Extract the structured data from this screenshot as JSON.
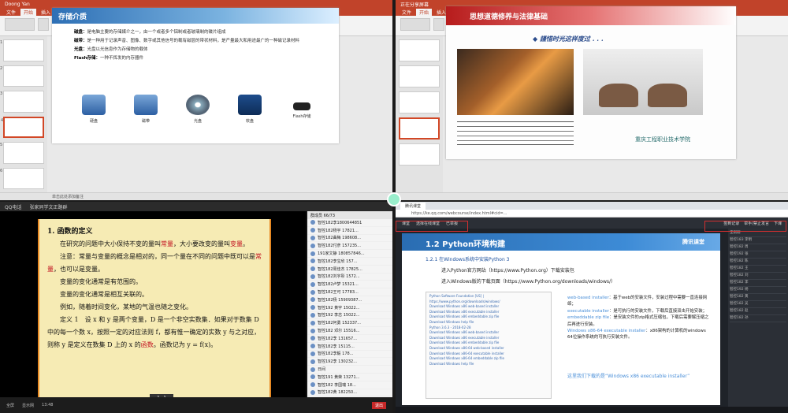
{
  "q1": {
    "title": "Doong Yan",
    "tabs": [
      "文件",
      "开始",
      "插入",
      "设计",
      "切换",
      "动画",
      "幻灯片放映",
      "审阅",
      "视图"
    ],
    "slide_header": "存储介质",
    "lines": [
      {
        "k": "磁盘：",
        "v": "是电脑主要的存储媒介之一，由一个或者多个铝制或者玻璃制的碟片组成"
      },
      {
        "k": "磁带：",
        "v": "是一种用于记录声音、图像、数字或其他信号的载有磁层的带状材料，是产量最大和用途最广的一种磁记录材料"
      },
      {
        "k": "光盘：",
        "v": "光盘以光信息作为存储物的载体"
      },
      {
        "k": "Flash存储：",
        "v": "一种不挥发的内存器件"
      }
    ],
    "icons": [
      {
        "name": "disk-icon",
        "label": "硬盘",
        "cls": ""
      },
      {
        "name": "tape-icon",
        "label": "磁带",
        "cls": ""
      },
      {
        "name": "cd-icon",
        "label": "光盘",
        "cls": "disc"
      },
      {
        "name": "floppy-icon",
        "label": "软盘",
        "cls": "floppy"
      },
      {
        "name": "usb-icon",
        "label": "Flash存储",
        "cls": "usb"
      }
    ],
    "status": "单击此处添加备注"
  },
  "q2": {
    "title": "正在分享屏幕",
    "tabs": [
      "文件",
      "开始",
      "插入",
      "设计",
      "切换",
      "动画",
      "幻灯片放映",
      "审阅",
      "视图"
    ],
    "slide_header": "思想道德修养与法律基础",
    "subtitle": "◆ 謹惜时光这样度过 . . .",
    "logo": "重庆工程职业技术学院"
  },
  "q3": {
    "bar_items": [
      "QQ电话",
      "张家同学文正路群"
    ],
    "heading": "1. 函数的定义",
    "paras": [
      "在研究的问题中大小保持不变的量叫常量，大小要改变的量叫变量。",
      "注意：常量与变量的概念是相对的，同一个量在不同的问题中既可以是常量，也可以是变量。",
      "变量的变化通常是有范围的。",
      "变量的变化通常是相互关联的。",
      "例如，随着时间变化，某地的气温也随之变化。",
      "定义 1　设 x 和 y 是两个变量，D 是一个非空实数集．如果对于数集 D 中的每一个数 x，按照一定的对应法则 f，都有惟一确定的实数 y 与之对应，则称 y 是定义在数集 D 上的 x 的函数。函数记为 y = f(x)。"
    ],
    "pager": "1 - 1",
    "members_title": "群成员 66/73",
    "members": [
      "智控182李1800644851",
      "智控182杨宇 17821...",
      "智控182曲梅 198608...",
      "智控182付彦 157235...",
      "191家文静 180857846...",
      "智控182李宝欣 157...",
      "智控182周佳杰 17825...",
      "智控182刘宇彤 1572...",
      "智控182卢梦 15321...",
      "智控182王可 17783...",
      "智控182杨 15909387...",
      "智控192 黄宇 15022...",
      "智控192 李志 15022...",
      "智控182何勇 152337...",
      "智控182 邓尔 15516...",
      "智控182李 131657...",
      "智控182李 15115...",
      "智控182李毅 178...",
      "智控192李 130232...",
      "日间",
      "智控191 黄荣 13271...",
      "智控182 李国瑞 18...",
      "智控182黄 182250...",
      "智控182 蒋天 1767...",
      "智控182 何婷 12227...",
      "智控182何 1816..."
    ],
    "bottom": [
      "全屏",
      "显示网",
      "13:48",
      "退出"
    ]
  },
  "q4": {
    "tab": "腾讯课堂",
    "addr": "https://ke.qq.com/webcourse/index.html#cid=...",
    "bar_items": [
      "课堂",
      "选择在线课堂",
      "已举报"
    ],
    "bar_right": [
      "签到记录",
      "举手/禁止发言",
      "下课"
    ],
    "slide_title": "1.2 Python环境构建",
    "brand": "腾讯课堂",
    "section": "1.2.1 在Windows系统中安装Python 3",
    "line1": "进入Python官方网站（https://www.Python.org）下载安装包",
    "line2": "进入Windows版的下载页面（https://www.Python.org/downloads/windows/）",
    "shot_lines": [
      "Python Software Foundation [US] | https://www.python.org/downloads/windows/",
      "Download Windows x86 web-based installer",
      "Download Windows x86 executable installer",
      "Download Windows x86 embeddable zip file",
      "Download Windows help file",
      "Python 3.6.3 - 2018-02-28",
      "Download Windows x86 web-based installer",
      "Download Windows x86 executable installer",
      "Download Windows x86 embeddable zip file",
      "Download Windows x86-64 web-based installer",
      "Download Windows x86-64 executable installer",
      "Download Windows x86-64 embeddable zip file",
      "Download Windows help file"
    ],
    "anno": [
      {
        "b": "web-based installer",
        "t": "：基于web的安装文件，安装过程中需要一直连接网络；"
      },
      {
        "b": "executable installer",
        "t": "：是可执行的安装文件，下载后直接双击开始安装；"
      },
      {
        "b": "embeddable zip file",
        "t": "：是安装文件的zip格式压缩包，下载后需要解压缩之后再进行安装。"
      },
      {
        "b": "Windows x86-64 executable installer",
        "t": "：x86架构的计算机的windows 64位操作系统的可执行安装文件。"
      }
    ],
    "foot": "这里我们下载的是“Windows x86 executable installer”",
    "side": [
      "王刚刚",
      "智控183 李明",
      "智控182 周",
      "智控192 张",
      "智控182 陈",
      "智控182 王",
      "智控182 刘",
      "智控182 李",
      "智控192 杨",
      "智控182 黄",
      "智控182 吴",
      "智控182 赵",
      "智控182 孙"
    ]
  }
}
